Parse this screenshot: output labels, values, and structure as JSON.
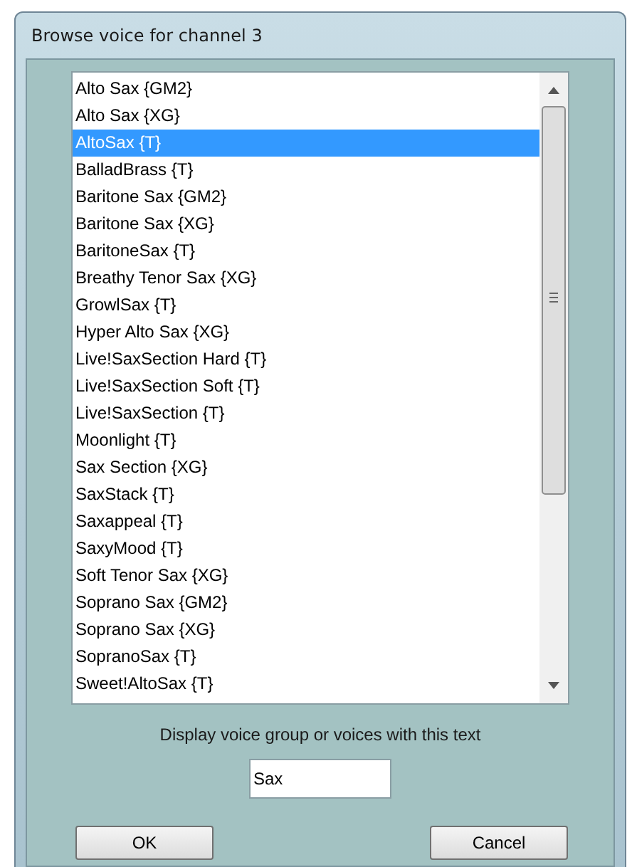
{
  "window": {
    "title": "Browse voice for channel 3"
  },
  "voices": [
    {
      "label": "Alto Sax {GM2}",
      "selected": false
    },
    {
      "label": "Alto Sax {XG}",
      "selected": false
    },
    {
      "label": "AltoSax {T}",
      "selected": true
    },
    {
      "label": "BalladBrass {T}",
      "selected": false
    },
    {
      "label": "Baritone Sax {GM2}",
      "selected": false
    },
    {
      "label": "Baritone Sax {XG}",
      "selected": false
    },
    {
      "label": "BaritoneSax {T}",
      "selected": false
    },
    {
      "label": "Breathy Tenor Sax {XG}",
      "selected": false
    },
    {
      "label": "GrowlSax {T}",
      "selected": false
    },
    {
      "label": "Hyper Alto Sax {XG}",
      "selected": false
    },
    {
      "label": "Live!SaxSection Hard {T}",
      "selected": false
    },
    {
      "label": "Live!SaxSection Soft {T}",
      "selected": false
    },
    {
      "label": "Live!SaxSection {T}",
      "selected": false
    },
    {
      "label": "Moonlight {T}",
      "selected": false
    },
    {
      "label": "Sax Section {XG}",
      "selected": false
    },
    {
      "label": "SaxStack {T}",
      "selected": false
    },
    {
      "label": "Saxappeal {T}",
      "selected": false
    },
    {
      "label": "SaxyMood {T}",
      "selected": false
    },
    {
      "label": "Soft Tenor Sax {XG}",
      "selected": false
    },
    {
      "label": "Soprano Sax {GM2}",
      "selected": false
    },
    {
      "label": "Soprano Sax {XG}",
      "selected": false
    },
    {
      "label": "SopranoSax {T}",
      "selected": false
    },
    {
      "label": "Sweet!AltoSax {T}",
      "selected": false
    }
  ],
  "filter": {
    "label": "Display voice group or voices with this text",
    "value": "Sax"
  },
  "buttons": [
    "OK",
    "Cancel"
  ]
}
